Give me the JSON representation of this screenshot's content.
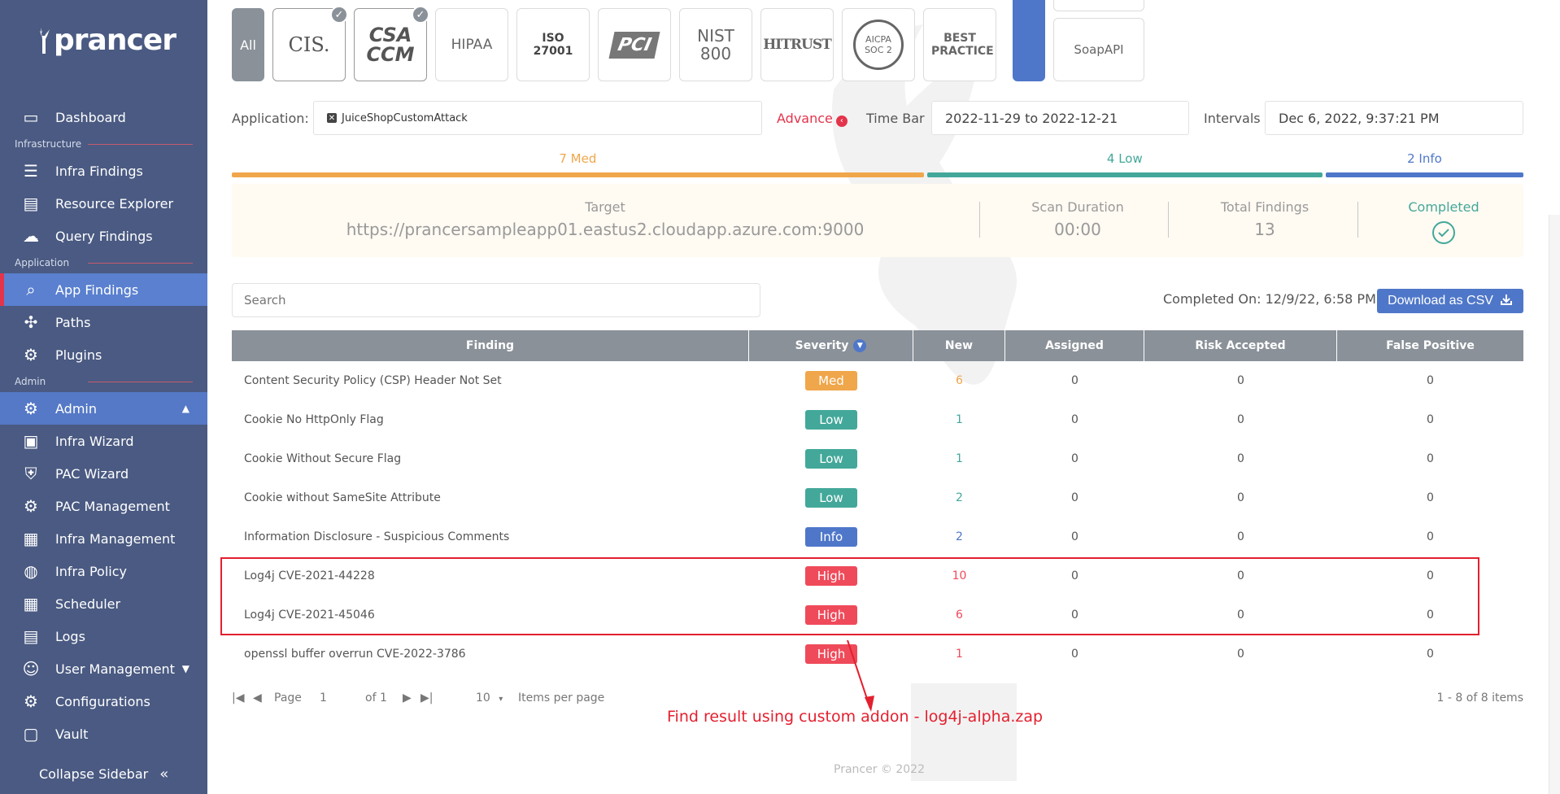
{
  "brand": {
    "name": "prancer"
  },
  "sidebar": {
    "items": [
      {
        "type": "item",
        "label": "Dashboard",
        "icon": "dashboard-icon"
      },
      {
        "type": "section",
        "label": "Infrastructure"
      },
      {
        "type": "item",
        "label": "Infra Findings",
        "icon": "list-icon"
      },
      {
        "type": "item",
        "label": "Resource Explorer",
        "icon": "resource-icon"
      },
      {
        "type": "item",
        "label": "Query Findings",
        "icon": "cloud-icon"
      },
      {
        "type": "section",
        "label": "Application"
      },
      {
        "type": "item",
        "label": "App Findings",
        "icon": "search-icon",
        "active": true
      },
      {
        "type": "item",
        "label": "Paths",
        "icon": "paths-icon"
      },
      {
        "type": "item",
        "label": "Plugins",
        "icon": "plugin-icon"
      },
      {
        "type": "section",
        "label": "Admin"
      },
      {
        "type": "item",
        "label": "Admin",
        "icon": "admin-icon",
        "expanded": true
      },
      {
        "type": "item",
        "label": "Infra Wizard",
        "icon": "wizard-icon"
      },
      {
        "type": "item",
        "label": "PAC Wizard",
        "icon": "shield-icon"
      },
      {
        "type": "item",
        "label": "PAC Management",
        "icon": "gear-icon"
      },
      {
        "type": "item",
        "label": "Infra Management",
        "icon": "document-icon"
      },
      {
        "type": "item",
        "label": "Infra Policy",
        "icon": "globe-icon"
      },
      {
        "type": "item",
        "label": "Scheduler",
        "icon": "calendar-icon"
      },
      {
        "type": "item",
        "label": "Logs",
        "icon": "log-icon"
      },
      {
        "type": "item",
        "label": "User Management",
        "icon": "users-icon",
        "collapsible": true
      },
      {
        "type": "item",
        "label": "Configurations",
        "icon": "config-icon"
      },
      {
        "type": "item",
        "label": "Vault",
        "icon": "vault-icon"
      }
    ],
    "collapse_label": "Collapse Sidebar"
  },
  "compliance": {
    "all_label": "All",
    "items": [
      {
        "label": "CIS.",
        "selected": true
      },
      {
        "label": "CSA CCM",
        "selected": true
      },
      {
        "label": "HIPAA",
        "selected": false
      },
      {
        "label": "ISO 27001",
        "selected": false
      },
      {
        "label": "PCI",
        "selected": false
      },
      {
        "label": "NIST 800",
        "selected": false
      },
      {
        "label": "HITRUST",
        "selected": false
      },
      {
        "label": "AICPA SOC 2",
        "selected": false
      },
      {
        "label": "BEST PRACTICE",
        "selected": false
      }
    ],
    "soap_label": "SoapAPI"
  },
  "filters": {
    "application_label": "Application:",
    "application_value": "JuiceShopCustomAttack",
    "advance_label": "Advance",
    "timebar_label": "Time Bar",
    "timebar_value": "2022-11-29 to 2022-12-21",
    "intervals_label": "Intervals",
    "intervals_value": "Dec 6, 2022, 9:37:21 PM"
  },
  "severity_bars": [
    {
      "label": "7 Med",
      "color": "#f0a64a",
      "count": 7
    },
    {
      "label": "4 Low",
      "color": "#43a89a",
      "count": 4
    },
    {
      "label": "2 Info",
      "color": "#4f77c9",
      "count": 2
    }
  ],
  "summary": {
    "target_label": "Target",
    "target_value": "https://prancersampleapp01.eastus2.cloudapp.azure.com:9000",
    "duration_label": "Scan Duration",
    "duration_value": "00:00",
    "total_label": "Total Findings",
    "total_value": "13",
    "status_label": "Completed"
  },
  "toolbar": {
    "search_placeholder": "Search",
    "completed_on": "Completed On: 12/9/22, 6:58 PM",
    "csv_label": "Download as CSV"
  },
  "table": {
    "columns": [
      "Finding",
      "Severity",
      "New",
      "Assigned",
      "Risk Accepted",
      "False Positive"
    ],
    "rows": [
      {
        "finding": "Content Security Policy (CSP) Header Not Set",
        "severity": "Med",
        "new": "6",
        "assigned": "0",
        "risk": "0",
        "fp": "0"
      },
      {
        "finding": "Cookie No HttpOnly Flag",
        "severity": "Low",
        "new": "1",
        "assigned": "0",
        "risk": "0",
        "fp": "0"
      },
      {
        "finding": "Cookie Without Secure Flag",
        "severity": "Low",
        "new": "1",
        "assigned": "0",
        "risk": "0",
        "fp": "0"
      },
      {
        "finding": "Cookie without SameSite Attribute",
        "severity": "Low",
        "new": "2",
        "assigned": "0",
        "risk": "0",
        "fp": "0"
      },
      {
        "finding": "Information Disclosure - Suspicious Comments",
        "severity": "Info",
        "new": "2",
        "assigned": "0",
        "risk": "0",
        "fp": "0"
      },
      {
        "finding": "Log4j CVE-2021-44228",
        "severity": "High",
        "new": "10",
        "assigned": "0",
        "risk": "0",
        "fp": "0"
      },
      {
        "finding": "Log4j CVE-2021-45046",
        "severity": "High",
        "new": "6",
        "assigned": "0",
        "risk": "0",
        "fp": "0"
      },
      {
        "finding": "openssl buffer overrun CVE-2022-3786",
        "severity": "High",
        "new": "1",
        "assigned": "0",
        "risk": "0",
        "fp": "0"
      }
    ]
  },
  "severity_colors": {
    "Med": "#f0a64a",
    "Low": "#43a89a",
    "Info": "#4f77c9",
    "High": "#ef4a5a"
  },
  "pager": {
    "page_label": "Page",
    "page_value": "1",
    "of_label": "of 1",
    "per_page_value": "10",
    "per_page_label": "Items per page",
    "range_label": "1 - 8 of 8 items"
  },
  "annotation": {
    "text": "Find result using custom addon - log4j-alpha.zap"
  },
  "footer": {
    "copyright": "Prancer © 2022"
  }
}
